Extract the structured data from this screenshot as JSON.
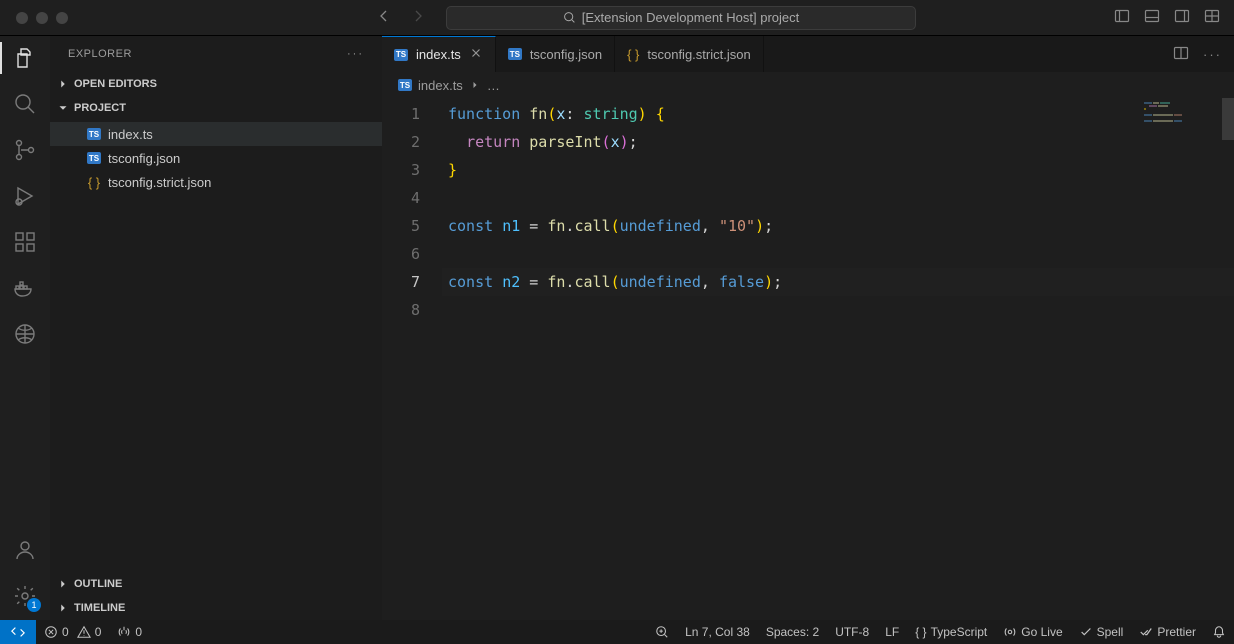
{
  "titlebar": {
    "title": "[Extension Development Host] project"
  },
  "sidebar": {
    "title": "EXPLORER",
    "sections": {
      "open_editors": "OPEN EDITORS",
      "project": "PROJECT",
      "outline": "OUTLINE",
      "timeline": "TIMELINE"
    },
    "files": [
      {
        "name": "index.ts",
        "icon": "ts",
        "selected": true
      },
      {
        "name": "tsconfig.json",
        "icon": "ts-json",
        "selected": false
      },
      {
        "name": "tsconfig.strict.json",
        "icon": "json",
        "selected": false
      }
    ]
  },
  "tabs": [
    {
      "label": "index.ts",
      "icon": "ts",
      "active": true,
      "close": true
    },
    {
      "label": "tsconfig.json",
      "icon": "ts-json",
      "active": false,
      "close": false
    },
    {
      "label": "tsconfig.strict.json",
      "icon": "json",
      "active": false,
      "close": false
    }
  ],
  "breadcrumb": {
    "file": "index.ts",
    "more": "…"
  },
  "code": {
    "current_line": 7,
    "lines": [
      {
        "n": 1,
        "tokens": [
          [
            "kw",
            "function"
          ],
          [
            "punc",
            " "
          ],
          [
            "fn",
            "fn"
          ],
          [
            "brace-y",
            "("
          ],
          [
            "var",
            "x"
          ],
          [
            "punc",
            ": "
          ],
          [
            "type",
            "string"
          ],
          [
            "brace-y",
            ")"
          ],
          [
            "punc",
            " "
          ],
          [
            "brace-y",
            "{"
          ]
        ]
      },
      {
        "n": 2,
        "tokens": [
          [
            "punc",
            "  "
          ],
          [
            "kw2",
            "return"
          ],
          [
            "punc",
            " "
          ],
          [
            "fn",
            "parseInt"
          ],
          [
            "brace-p",
            "("
          ],
          [
            "var",
            "x"
          ],
          [
            "brace-p",
            ")"
          ],
          [
            "punc",
            ";"
          ]
        ]
      },
      {
        "n": 3,
        "tokens": [
          [
            "brace-y",
            "}"
          ]
        ]
      },
      {
        "n": 4,
        "tokens": []
      },
      {
        "n": 5,
        "tokens": [
          [
            "kw",
            "const"
          ],
          [
            "punc",
            " "
          ],
          [
            "const2",
            "n1"
          ],
          [
            "punc",
            " = "
          ],
          [
            "fn",
            "fn"
          ],
          [
            "punc",
            "."
          ],
          [
            "fn",
            "call"
          ],
          [
            "brace-y",
            "("
          ],
          [
            "const",
            "undefined"
          ],
          [
            "punc",
            ", "
          ],
          [
            "str",
            "\"10\""
          ],
          [
            "brace-y",
            ")"
          ],
          [
            "punc",
            ";"
          ]
        ]
      },
      {
        "n": 6,
        "tokens": []
      },
      {
        "n": 7,
        "tokens": [
          [
            "kw",
            "const"
          ],
          [
            "punc",
            " "
          ],
          [
            "const2",
            "n2"
          ],
          [
            "punc",
            " = "
          ],
          [
            "fn",
            "fn"
          ],
          [
            "punc",
            "."
          ],
          [
            "fn",
            "call"
          ],
          [
            "brace-y",
            "("
          ],
          [
            "const",
            "undefined"
          ],
          [
            "punc",
            ", "
          ],
          [
            "const",
            "false"
          ],
          [
            "brace-y",
            ")"
          ],
          [
            "punc",
            ";"
          ]
        ]
      },
      {
        "n": 8,
        "tokens": []
      }
    ]
  },
  "statusbar": {
    "errors": "0",
    "warnings": "0",
    "ports": "0",
    "cursor": "Ln 7, Col 38",
    "spaces": "Spaces: 2",
    "encoding": "UTF-8",
    "eol": "LF",
    "language": "TypeScript",
    "golive": "Go Live",
    "spell": "Spell",
    "prettier": "Prettier"
  },
  "activitybar": {
    "settings_badge": "1"
  }
}
